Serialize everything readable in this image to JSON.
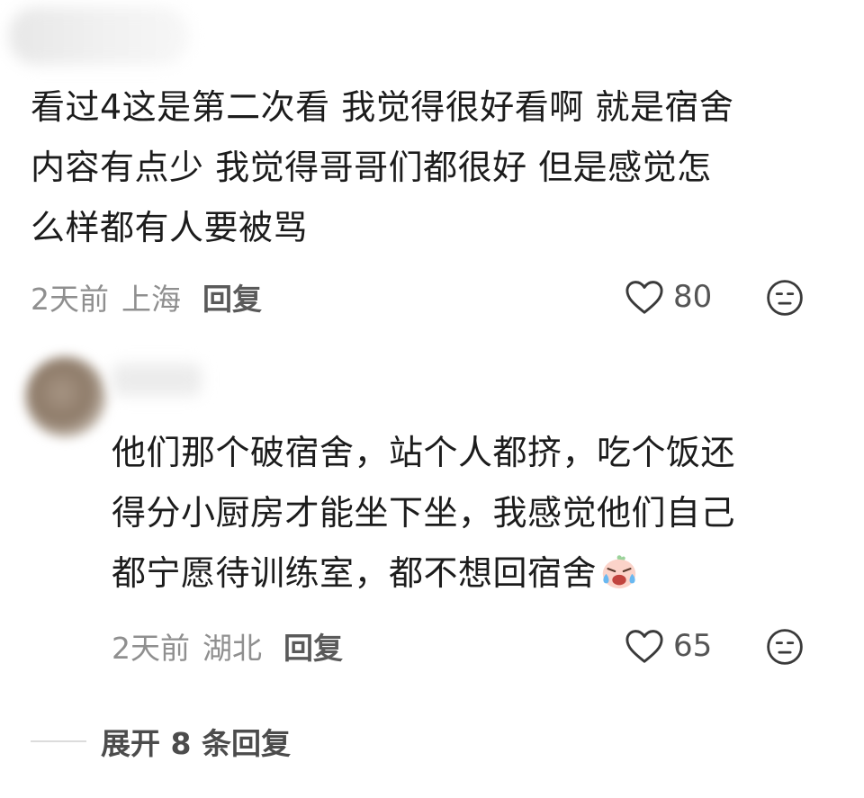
{
  "comments": [
    {
      "text": "看过4这是第二次看 我觉得很好看啊 就是宿舍\n内容有点少 我觉得哥哥们都很好 但是感觉怎\n么样都有人要被骂",
      "time": "2天前",
      "location": "上海",
      "reply_label": "回复",
      "likes": "80",
      "like_icon": "heart-outline-icon",
      "dislike_icon": "neutral-face-icon"
    },
    {
      "text": "他们那个破宿舍，站个人都挤，吃个饭还\n得分小厨房才能坐下坐，我感觉他们自己\n都宁愿待训练室，都不想回宿舍",
      "emoji": "crying-face-emoji",
      "time": "2天前",
      "location": "湖北",
      "reply_label": "回复",
      "likes": "65",
      "like_icon": "heart-outline-icon",
      "dislike_icon": "neutral-face-icon"
    }
  ],
  "expand_replies": "展开 8 条回复"
}
